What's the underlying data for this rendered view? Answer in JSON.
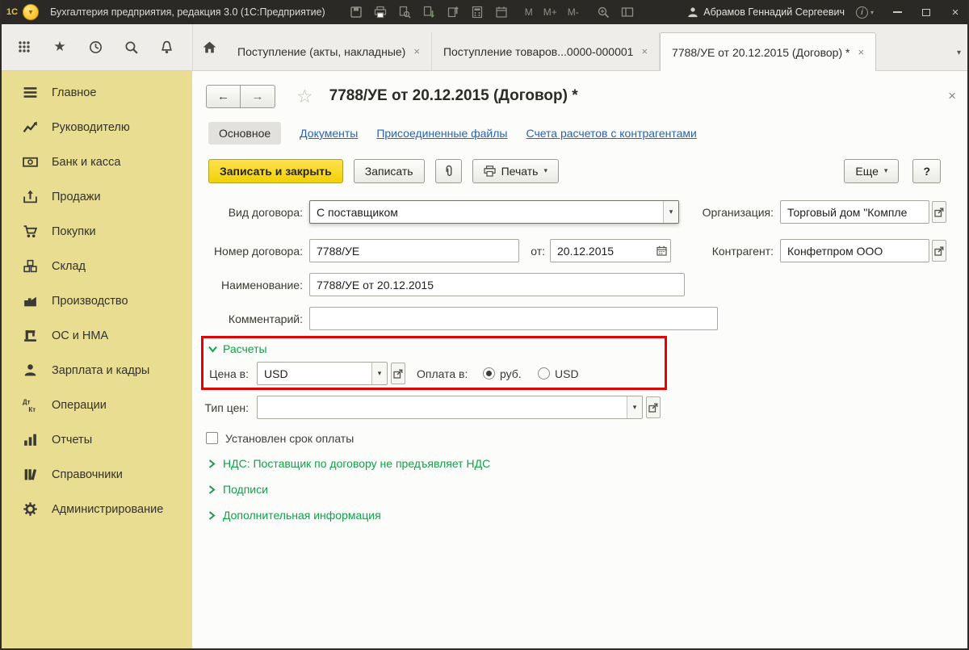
{
  "titlebar": {
    "logo_text": "1С",
    "app_title": "Бухгалтерия предприятия, редакция 3.0 (1С:Предприятие)",
    "memory_buttons": [
      "М",
      "М+",
      "М-"
    ],
    "user_name": "Абрамов Геннадий Сергеевич"
  },
  "tabbar": {
    "tabs": [
      {
        "label": "Поступление (акты, накладные)",
        "active": false
      },
      {
        "label": "Поступление товаров...0000-000001",
        "active": false
      },
      {
        "label": "7788/УЕ от 20.12.2015 (Договор) *",
        "active": true
      }
    ]
  },
  "sidebar": {
    "items": [
      {
        "label": "Главное"
      },
      {
        "label": "Руководителю"
      },
      {
        "label": "Банк и касса"
      },
      {
        "label": "Продажи"
      },
      {
        "label": "Покупки"
      },
      {
        "label": "Склад"
      },
      {
        "label": "Производство"
      },
      {
        "label": "ОС и НМА"
      },
      {
        "label": "Зарплата и кадры"
      },
      {
        "label": "Операции"
      },
      {
        "label": "Отчеты"
      },
      {
        "label": "Справочники"
      },
      {
        "label": "Администрирование"
      }
    ]
  },
  "form": {
    "title": "7788/УЕ от 20.12.2015 (Договор) *",
    "nav_links": [
      {
        "label": "Основное",
        "active": true
      },
      {
        "label": "Документы",
        "active": false
      },
      {
        "label": "Присоединенные файлы",
        "active": false
      },
      {
        "label": "Счета расчетов с контрагентами",
        "active": false
      }
    ],
    "commands": {
      "save_and_close": "Записать и закрыть",
      "save": "Записать",
      "print": "Печать",
      "more": "Еще",
      "help": "?"
    },
    "fields": {
      "contract_type_label": "Вид договора:",
      "contract_type_value": "С поставщиком",
      "organization_label": "Организация:",
      "organization_value": "Торговый дом \"Компле",
      "contract_number_label": "Номер договора:",
      "contract_number_value": "7788/УЕ",
      "date_label": "от:",
      "date_value": "20.12.2015",
      "counterparty_label": "Контрагент:",
      "counterparty_value": "Конфетпром ООО",
      "name_label": "Наименование:",
      "name_value": "7788/УЕ от 20.12.2015",
      "comment_label": "Комментарий:",
      "comment_value": "",
      "price_in_label": "Цена в:",
      "price_in_value": "USD",
      "payment_in_label": "Оплата в:",
      "payment_rub_label": "руб.",
      "payment_usd_label": "USD",
      "payment_selected": "руб.",
      "price_type_label": "Тип цен:",
      "price_type_value": "",
      "payment_term_label": "Установлен срок оплаты",
      "payment_term_checked": false
    },
    "sections": {
      "calculations": "Расчеты",
      "vat": "НДС: Поставщик по договору не предъявляет НДС",
      "signatures": "Подписи",
      "additional_info": "Дополнительная информация"
    }
  },
  "glyphs": {
    "close": "×",
    "dropdown": "▾",
    "back": "←",
    "forward": "→",
    "star_outline": "☆",
    "star_filled": "★",
    "info": "i"
  },
  "colors": {
    "titlebar_bg": "#2a2925",
    "sidebar_bg": "#e9dd92",
    "accent_yellow_button": "#f2d104",
    "section_green": "#14a04b",
    "link_blue": "#2565b2",
    "annotation_red": "#e10404"
  }
}
